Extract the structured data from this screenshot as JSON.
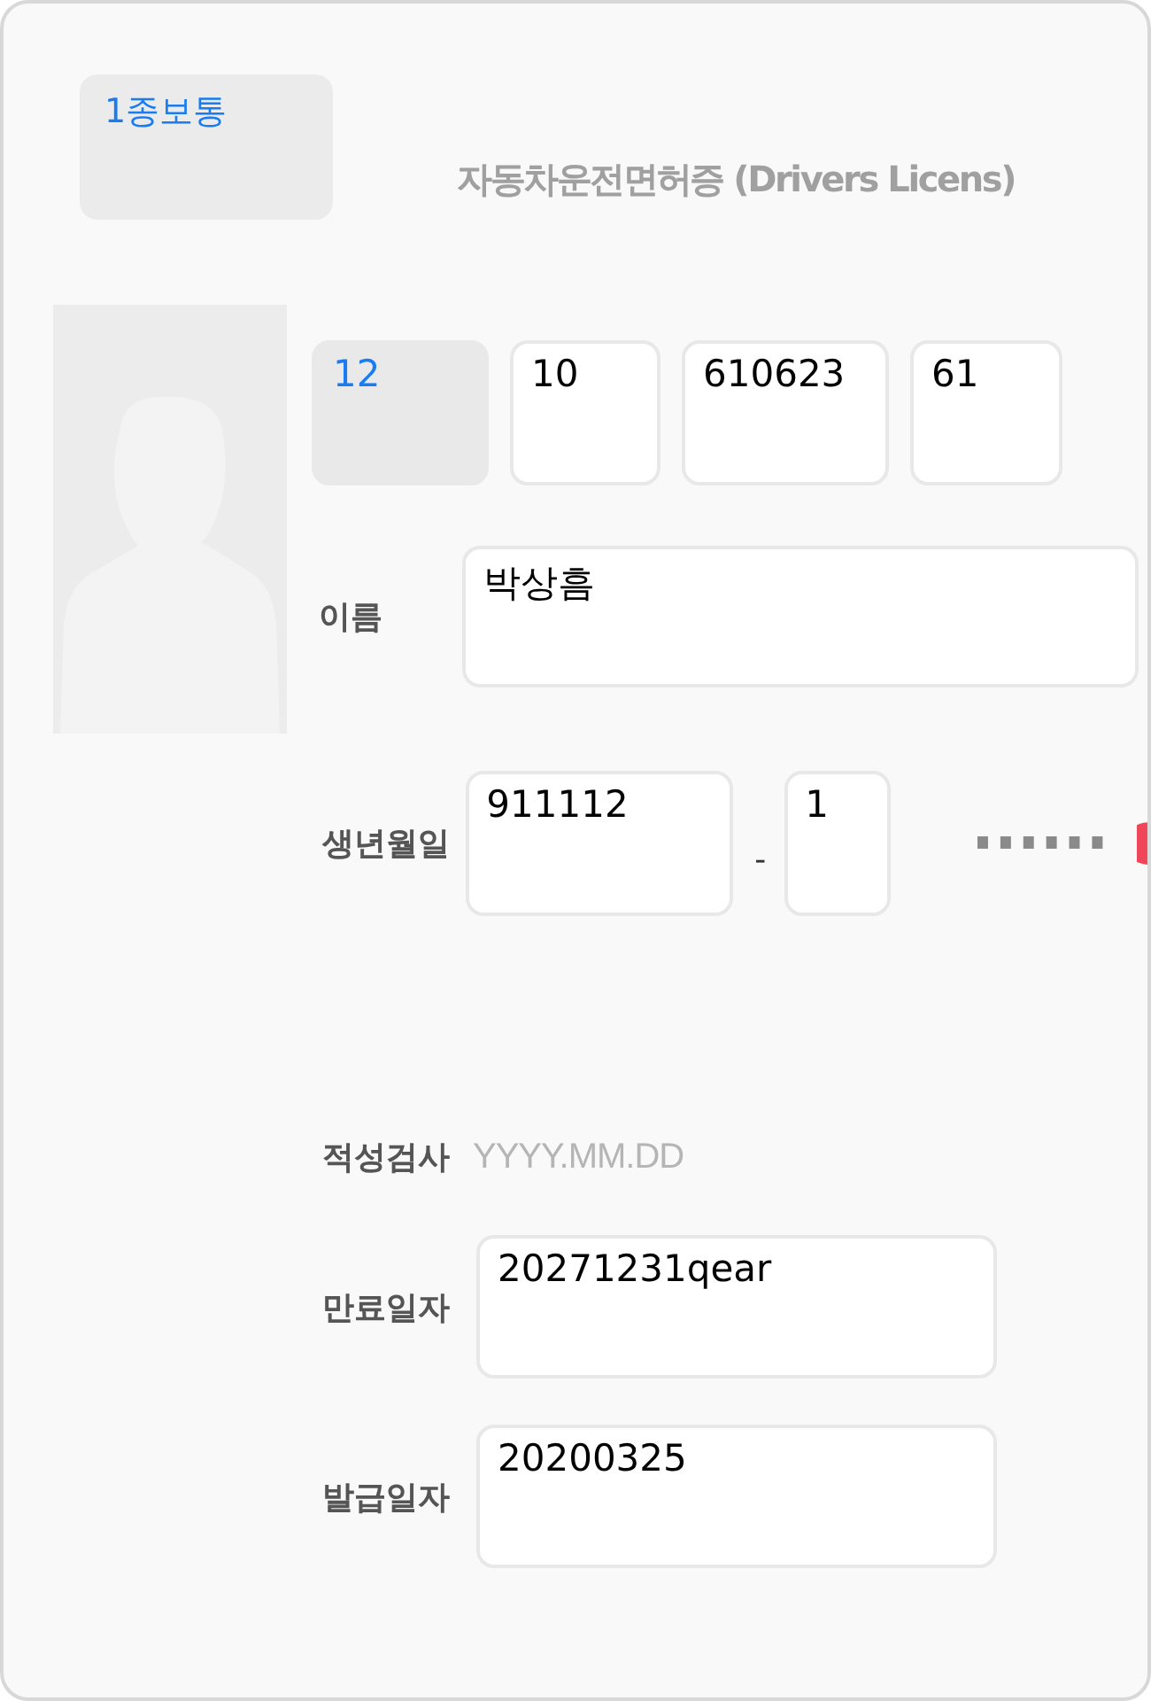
{
  "license_class": {
    "value": "1종보통"
  },
  "title": "자동차운전면허증 (Drivers Licens)",
  "license_number": [
    {
      "kind": "region",
      "value": "12"
    },
    {
      "kind": "field",
      "value": "10"
    },
    {
      "kind": "field",
      "value": "610623"
    },
    {
      "kind": "field",
      "value": "61"
    }
  ],
  "name": {
    "label": "이름",
    "value": "박상흠"
  },
  "birth_date": {
    "label": "생년월일",
    "front": "911112",
    "separator": "-",
    "back": "1",
    "masked": true
  },
  "aptitude_test": {
    "label": "적성검사",
    "placeholder": "YYYY.MM.DD"
  },
  "expiry_date": {
    "label": "만료일자",
    "value": "20271231qear"
  },
  "issue_date": {
    "label": "발급일자",
    "value": "20200325"
  }
}
